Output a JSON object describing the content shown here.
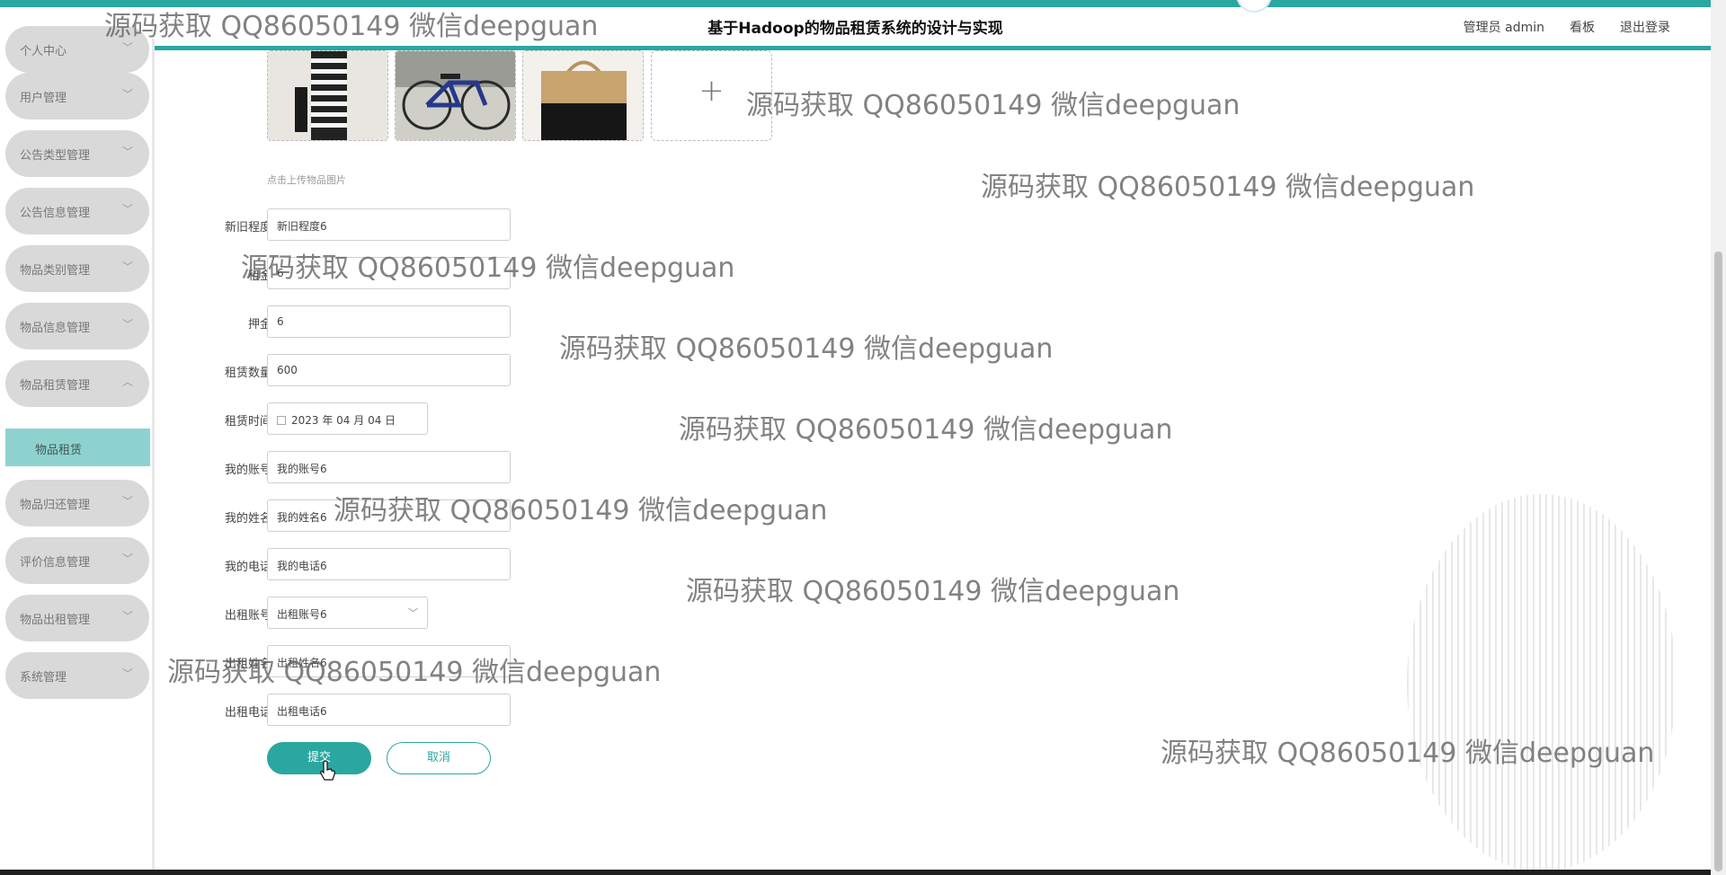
{
  "header": {
    "title": "基于Hadoop的物品租赁系统的设计与实现",
    "user_label": "管理员 admin",
    "dashboard_link": "看板",
    "logout_link": "退出登录"
  },
  "sidebar": {
    "items": [
      {
        "label": "个人中心"
      },
      {
        "label": "用户管理"
      },
      {
        "label": "公告类型管理"
      },
      {
        "label": "公告信息管理"
      },
      {
        "label": "物品类别管理"
      },
      {
        "label": "物品信息管理"
      },
      {
        "label": "物品租赁管理"
      },
      {
        "label": "物品归还管理"
      },
      {
        "label": "评价信息管理"
      },
      {
        "label": "物品出租管理"
      },
      {
        "label": "系统管理"
      }
    ],
    "active_sub_item": "物品租赁"
  },
  "form": {
    "upload_hint": "点击上传物品图片",
    "images": [
      "striped-dress-photo",
      "bicycle-photo",
      "woven-bag-photo"
    ],
    "fields": [
      {
        "label": "新旧程度",
        "value": "新旧程度6"
      },
      {
        "label": "租金",
        "value": "6"
      },
      {
        "label": "押金",
        "value": "6"
      },
      {
        "label": "租赁数量",
        "value": "600"
      },
      {
        "label": "租赁时间",
        "value": "2023 年 04 月 04 日"
      },
      {
        "label": "我的账号",
        "value": "我的账号6"
      },
      {
        "label": "我的姓名",
        "value": "我的姓名6"
      },
      {
        "label": "我的电话",
        "value": "我的电话6"
      },
      {
        "label": "出租账号",
        "value": "出租账号6"
      },
      {
        "label": "出租姓名",
        "value": "出租姓名6"
      },
      {
        "label": "出租电话",
        "value": "出租电话6"
      }
    ],
    "submit_label": "提交",
    "cancel_label": "取消"
  },
  "watermark": "源码获取 QQ86050149 微信deepguan",
  "colors": {
    "accent": "#2aa7a0",
    "active_menu": "#8ed2cf"
  }
}
